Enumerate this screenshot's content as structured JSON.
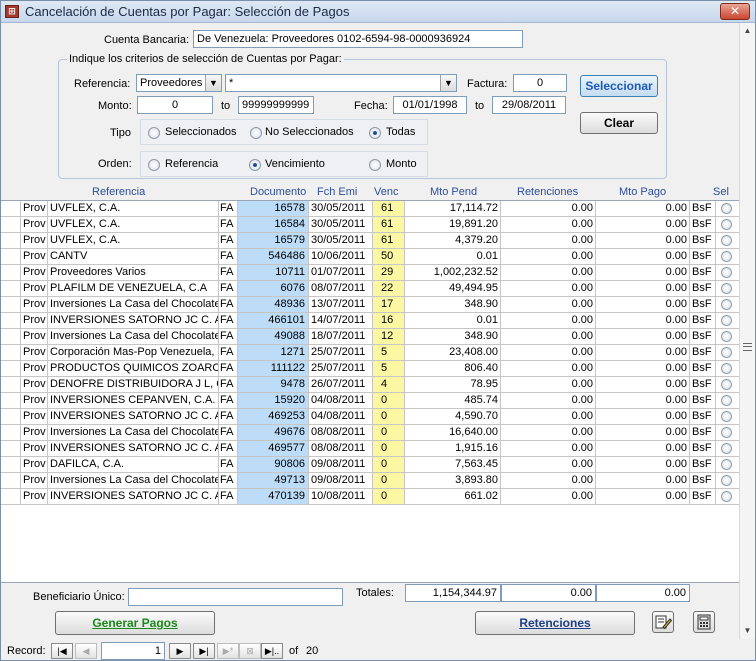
{
  "window": {
    "title": "Cancelación de Cuentas por Pagar: Selección de Pagos",
    "app_icon": "access-form-icon",
    "close_label": "✕"
  },
  "account": {
    "label": "Cuenta Bancaria:",
    "value": "De Venezuela: Proveedores 0102-6594-98-0000936924"
  },
  "criteria": {
    "title": "Indique los criterios de selección de Cuentas por Pagar:",
    "referencia_label": "Referencia:",
    "referencia_value": "Proveedores",
    "filter_value": "*",
    "factura_label": "Factura:",
    "factura_value": "0",
    "monto_label": "Monto:",
    "monto_from": "0",
    "to_label": "to",
    "monto_to": "99999999999",
    "fecha_label": "Fecha:",
    "fecha_from": "01/01/1998",
    "fecha_to": "29/08/2011",
    "tipo_label": "Tipo",
    "tipo_options": [
      "Seleccionados",
      "No Seleccionados",
      "Todas"
    ],
    "tipo_selected": "Todas",
    "orden_label": "Orden:",
    "orden_options": [
      "Referencia",
      "Vencimiento",
      "Monto"
    ],
    "orden_selected": "Vencimiento"
  },
  "buttons": {
    "seleccionar": "Seleccionar",
    "clear": "Clear",
    "generar": "Generar Pagos",
    "retenciones": "Retenciones"
  },
  "table": {
    "headers": {
      "referencia": "Referencia",
      "documento": "Documento",
      "fch_emi": "Fch Emi",
      "venc": "Venc",
      "mto_pend": "Mto Pend",
      "retenciones": "Retenciones",
      "mto_pago": "Mto Pago",
      "sel": "Sel"
    },
    "rows": [
      [
        "Prov",
        "UVFLEX, C.A.",
        "FA",
        "16578",
        "30/05/2011",
        "61",
        "17,114.72",
        "0.00",
        "0.00",
        "BsF"
      ],
      [
        "Prov",
        "UVFLEX, C.A.",
        "FA",
        "16584",
        "30/05/2011",
        "61",
        "19,891.20",
        "0.00",
        "0.00",
        "BsF"
      ],
      [
        "Prov",
        "UVFLEX, C.A.",
        "FA",
        "16579",
        "30/05/2011",
        "61",
        "4,379.20",
        "0.00",
        "0.00",
        "BsF"
      ],
      [
        "Prov",
        "CANTV",
        "FA",
        "546486",
        "10/06/2011",
        "50",
        "0.01",
        "0.00",
        "0.00",
        "BsF"
      ],
      [
        "Prov",
        "Proveedores Varios",
        "FA",
        "10711",
        "01/07/2011",
        "29",
        "1,002,232.52",
        "0.00",
        "0.00",
        "BsF"
      ],
      [
        "Prov",
        "PLAFILM DE VENEZUELA, C.A",
        "FA",
        "6076",
        "08/07/2011",
        "22",
        "49,494.95",
        "0.00",
        "0.00",
        "BsF"
      ],
      [
        "Prov",
        "Inversiones La Casa del Chocolate,",
        "FA",
        "48936",
        "13/07/2011",
        "17",
        "348.90",
        "0.00",
        "0.00",
        "BsF"
      ],
      [
        "Prov",
        "INVERSIONES SATORNO JC C. A",
        "FA",
        "466101",
        "14/07/2011",
        "16",
        "0.01",
        "0.00",
        "0.00",
        "BsF"
      ],
      [
        "Prov",
        "Inversiones La Casa del Chocolate,",
        "FA",
        "49088",
        "18/07/2011",
        "12",
        "348.90",
        "0.00",
        "0.00",
        "BsF"
      ],
      [
        "Prov",
        "Corporación Mas-Pop Venezuela, C",
        "FA",
        "1271",
        "25/07/2011",
        "5",
        "23,408.00",
        "0.00",
        "0.00",
        "BsF"
      ],
      [
        "Prov",
        "PRODUCTOS QUIMICOS ZOARO",
        "FA",
        "111122",
        "25/07/2011",
        "5",
        "806.40",
        "0.00",
        "0.00",
        "BsF"
      ],
      [
        "Prov",
        "DENOFRE DISTRIBUIDORA J L, C",
        "FA",
        "9478",
        "26/07/2011",
        "4",
        "78.95",
        "0.00",
        "0.00",
        "BsF"
      ],
      [
        "Prov",
        "INVERSIONES CEPANVEN, C.A.",
        "FA",
        "15920",
        "04/08/2011",
        "0",
        "485.74",
        "0.00",
        "0.00",
        "BsF"
      ],
      [
        "Prov",
        "INVERSIONES SATORNO JC C. A",
        "FA",
        "469253",
        "04/08/2011",
        "0",
        "4,590.70",
        "0.00",
        "0.00",
        "BsF"
      ],
      [
        "Prov",
        "Inversiones La Casa del Chocolate,",
        "FA",
        "49676",
        "08/08/2011",
        "0",
        "16,640.00",
        "0.00",
        "0.00",
        "BsF"
      ],
      [
        "Prov",
        "INVERSIONES SATORNO JC C. A",
        "FA",
        "469577",
        "08/08/2011",
        "0",
        "1,915.16",
        "0.00",
        "0.00",
        "BsF"
      ],
      [
        "Prov",
        "DAFILCA, C.A.",
        "FA",
        "90806",
        "09/08/2011",
        "0",
        "7,563.45",
        "0.00",
        "0.00",
        "BsF"
      ],
      [
        "Prov",
        "Inversiones La Casa del Chocolate,",
        "FA",
        "49713",
        "09/08/2011",
        "0",
        "3,893.80",
        "0.00",
        "0.00",
        "BsF"
      ],
      [
        "Prov",
        "INVERSIONES SATORNO JC C. A",
        "FA",
        "470139",
        "10/08/2011",
        "0",
        "661.02",
        "0.00",
        "0.00",
        "BsF"
      ]
    ]
  },
  "footer": {
    "beneficiario_label": "Beneficiario Único:",
    "beneficiario_value": "",
    "totales_label": "Totales:",
    "total_pend": "1,154,344.97",
    "total_ret": "0.00",
    "total_pago": "0.00"
  },
  "record_nav": {
    "label": "Record:",
    "current": "1",
    "of_label": "of",
    "total": "20"
  },
  "icons": {
    "edit": "edit-note-icon",
    "calculator": "calculator-icon"
  }
}
